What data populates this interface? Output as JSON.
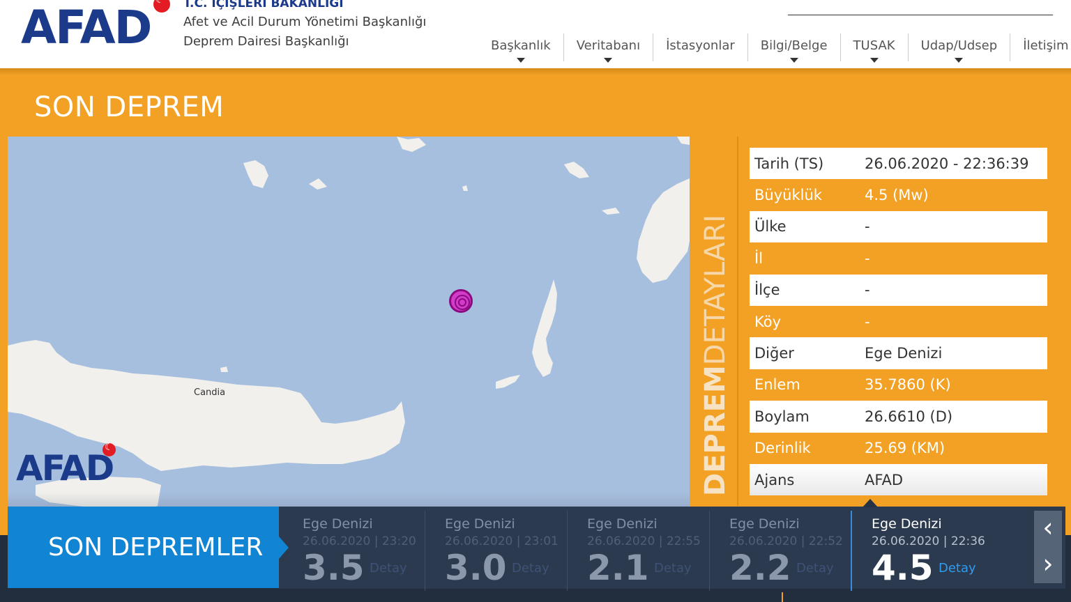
{
  "header": {
    "logo_text": "AFAD",
    "ministry": "T.C. İÇİŞLERİ BAKANLIĞI",
    "sub1": "Afet ve Acil Durum Yönetimi Başkanlığı",
    "sub2": "Deprem Dairesi Başkanlığı"
  },
  "nav": [
    {
      "label": "Başkanlık",
      "dropdown": true
    },
    {
      "label": "Veritabanı",
      "dropdown": true
    },
    {
      "label": "İstasyonlar",
      "dropdown": false
    },
    {
      "label": "Bilgi/Belge",
      "dropdown": true
    },
    {
      "label": "TUSAK",
      "dropdown": true
    },
    {
      "label": "Udap/Udsep",
      "dropdown": true
    },
    {
      "label": "İletişim",
      "dropdown": false
    }
  ],
  "section": {
    "title": "SON DEPREM",
    "vertical_bold": "DEPREM",
    "vertical_light": "DETAYLARI"
  },
  "map": {
    "city_label": "Candia",
    "watermark": "AFAD"
  },
  "details": [
    {
      "key": "Tarih (TS)",
      "value": "26.06.2020 - 22:36:39"
    },
    {
      "key": "Büyüklük",
      "value": "4.5 (Mw)"
    },
    {
      "key": "Ülke",
      "value": "-"
    },
    {
      "key": "İl",
      "value": "-"
    },
    {
      "key": "İlçe",
      "value": "-"
    },
    {
      "key": "Köy",
      "value": "-"
    },
    {
      "key": "Diğer",
      "value": "Ege Denizi"
    },
    {
      "key": "Enlem",
      "value": "35.7860 (K)"
    },
    {
      "key": "Boylam",
      "value": "26.6610 (D)"
    },
    {
      "key": "Derinlik",
      "value": "25.69 (KM)"
    },
    {
      "key": "Ajans",
      "value": "AFAD"
    }
  ],
  "recent": {
    "title": "SON DEPREMLER",
    "items": [
      {
        "place": "Ege Denizi",
        "date": "26.06.2020 | 23:20",
        "magnitude": "3.5",
        "detail": "Detay"
      },
      {
        "place": "Ege Denizi",
        "date": "26.06.2020 | 23:01",
        "magnitude": "3.0",
        "detail": "Detay"
      },
      {
        "place": "Ege Denizi",
        "date": "26.06.2020 | 22:55",
        "magnitude": "2.1",
        "detail": "Detay"
      },
      {
        "place": "Ege Denizi",
        "date": "26.06.2020 | 22:52",
        "magnitude": "2.2",
        "detail": "Detay"
      },
      {
        "place": "Ege Denizi",
        "date": "26.06.2020 | 22:36",
        "magnitude": "4.5",
        "detail": "Detay"
      }
    ],
    "prev_icon": "chevron-left-icon",
    "next_icon": "chevron-right-icon"
  },
  "colors": {
    "brand_blue": "#1b3a8a",
    "orange": "#f2a124",
    "accent_blue": "#1185d4",
    "dark": "#222d3e"
  }
}
